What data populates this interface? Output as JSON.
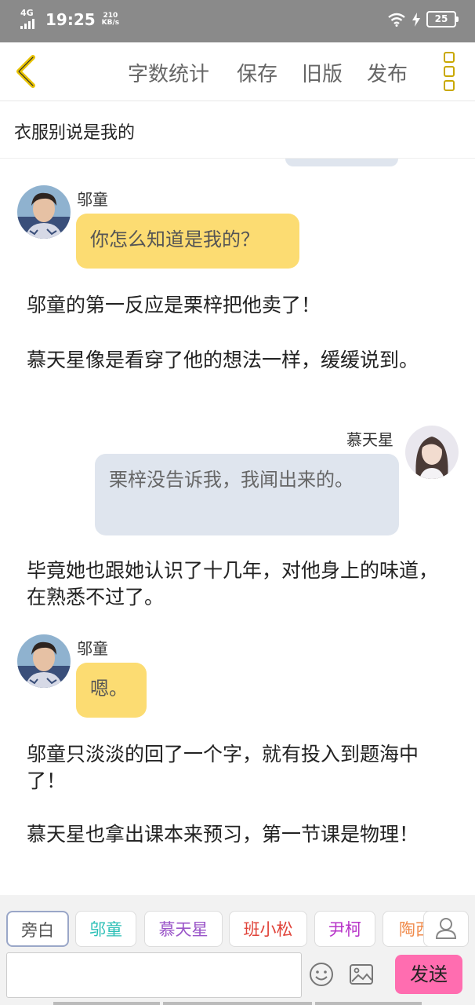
{
  "status_bar": {
    "network": "4G",
    "time": "19:25",
    "speed_value": "210",
    "speed_unit": "KB/s",
    "battery": "25",
    "wifi_icon": "wifi-icon",
    "charging_icon": "lightning-icon"
  },
  "toolbar": {
    "back_icon": "chevron-left-icon",
    "word_count": "字数统计",
    "save": "保存",
    "old_version": "旧版",
    "publish": "发布",
    "more_icon": "more-vertical-icon",
    "accent_color": "#e8c200"
  },
  "chapter_title": "衣服别说是我的",
  "messages": [
    {
      "type": "character",
      "side": "left",
      "name": "邬童",
      "text": "你怎么知道是我的？",
      "bubble_color": "#fcdc72"
    },
    {
      "type": "narration",
      "text": "邬童的第一反应是栗梓把他卖了！"
    },
    {
      "type": "narration",
      "text": "慕天星像是看穿了他的想法一样，缓缓说到。"
    },
    {
      "type": "character",
      "side": "right",
      "name": "慕天星",
      "text": "栗梓没告诉我，我闻出来的。",
      "bubble_color": "#dfe5ee"
    },
    {
      "type": "narration",
      "text": "毕竟她也跟她认识了十几年，对他身上的味道，在熟悉不过了。"
    },
    {
      "type": "character",
      "side": "left",
      "name": "邬童",
      "text": "嗯。",
      "bubble_color": "#fcdc72"
    },
    {
      "type": "narration",
      "text": "邬童只淡淡的回了一个字，就有投入到题海中了！"
    },
    {
      "type": "narration",
      "text": "慕天星也拿出课本来预习，第一节课是物理！"
    }
  ],
  "role_chips": [
    {
      "label": "旁白",
      "color": "#555555",
      "active": true
    },
    {
      "label": "邬童",
      "color": "#2bbfb6",
      "active": false
    },
    {
      "label": "慕天星",
      "color": "#9a55c8",
      "active": false
    },
    {
      "label": "班小松",
      "color": "#e0443a",
      "active": false
    },
    {
      "label": "尹柯",
      "color": "#b733c8",
      "active": false
    },
    {
      "label": "陶西",
      "color": "#f08a4a",
      "active": false
    }
  ],
  "input_bar": {
    "user_icon": "user-icon",
    "emoji_icon": "emoji-icon",
    "image_icon": "image-icon",
    "send": "发送",
    "send_color": "#ff6db0"
  }
}
